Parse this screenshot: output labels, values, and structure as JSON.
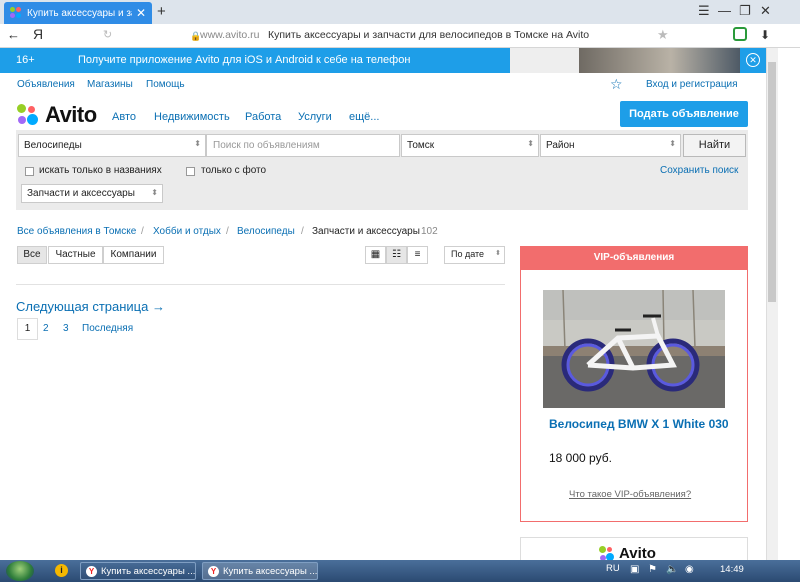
{
  "browser": {
    "tab_title": "Купить аксессуары и запч",
    "tab_close": "✕",
    "new_tab": "+",
    "window_controls": {
      "menu": "☰",
      "minimize": "—",
      "restore": "❐",
      "close": "✕"
    },
    "back": "←",
    "yandex_logo": "Я",
    "reload": "↻",
    "url_domain": "www.avito.ru",
    "page_title": "Купить аксессуары и запчасти для велосипедов в Томске на Avito",
    "star": "★",
    "download": "⬇"
  },
  "banner": {
    "age": "16+",
    "text": "Получите приложение Avito для iOS и Android к себе на телефон",
    "close": "✕"
  },
  "toplinks": {
    "ads": "Объявления",
    "shops": "Магазины",
    "help": "Помощь",
    "login": "Вход и регистрация"
  },
  "logo": {
    "text": "Avito",
    "dot_colors": [
      "#97cf26",
      "#ff6163",
      "#a169f7",
      "#00aaff"
    ]
  },
  "categories": {
    "auto": "Авто",
    "realty": "Недвижимость",
    "jobs": "Работа",
    "services": "Услуги",
    "more": "ещё..."
  },
  "post_button": "Подать объявление",
  "search": {
    "category": "Велосипеды",
    "query_placeholder": "Поиск по объявлениям",
    "city": "Томск",
    "district": "Район",
    "find_button": "Найти",
    "only_titles": "искать только в названиях",
    "only_photo": "только с фото",
    "save_search": "Сохранить поиск",
    "subcategory": "Запчасти и аксессуары"
  },
  "breadcrumbs": {
    "items": [
      "Все объявления в Томске",
      "Хобби и отдых",
      "Велосипеды"
    ],
    "current": "Запчасти и аксессуары",
    "count": "102",
    "sep": "/"
  },
  "filters": {
    "all": "Все",
    "private": "Частные",
    "companies": "Компании",
    "sort": "По дате"
  },
  "pagination": {
    "next": "Следующая страница →",
    "pages": [
      "1",
      "2",
      "3"
    ],
    "last": "Последняя"
  },
  "vip": {
    "header": "VIP-объявления",
    "title": "Велосипед BMW X 1 White 030",
    "price": "18 000 руб.",
    "what": "Что такое VIP-объявления?"
  },
  "taskbar": {
    "tasks": [
      "Купить аксессуары ...",
      "Купить аксессуары ..."
    ],
    "lang": "RU",
    "time": "14:49"
  },
  "colors": {
    "brand_blue": "#1e9ee8",
    "link": "#0a6fb3",
    "vip_red": "#f26d6d"
  }
}
